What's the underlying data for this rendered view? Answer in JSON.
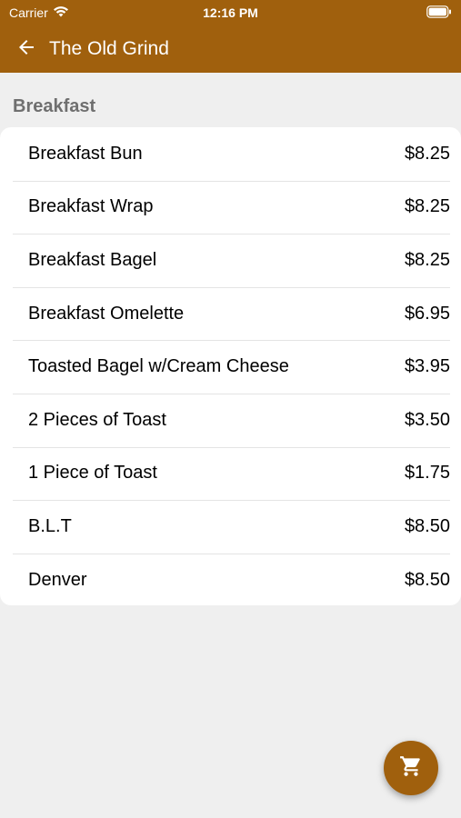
{
  "status_bar": {
    "carrier": "Carrier",
    "time": "12:16 PM"
  },
  "nav": {
    "title": "The Old Grind",
    "back_icon": "arrow-left-icon"
  },
  "colors": {
    "brand": "#a0600d",
    "background": "#efefef",
    "section_header": "#6f6f6f"
  },
  "section": {
    "title": "Breakfast",
    "items": [
      {
        "name": "Breakfast Bun",
        "price": "$8.25"
      },
      {
        "name": "Breakfast Wrap",
        "price": "$8.25"
      },
      {
        "name": "Breakfast Bagel",
        "price": "$8.25"
      },
      {
        "name": "Breakfast Omelette",
        "price": "$6.95"
      },
      {
        "name": "Toasted Bagel w/Cream Cheese",
        "price": "$3.95"
      },
      {
        "name": "2 Pieces of Toast",
        "price": "$3.50"
      },
      {
        "name": "1 Piece of Toast",
        "price": "$1.75"
      },
      {
        "name": "B.L.T",
        "price": "$8.50"
      },
      {
        "name": "Denver",
        "price": "$8.50"
      }
    ]
  },
  "fab": {
    "icon": "cart-icon"
  }
}
